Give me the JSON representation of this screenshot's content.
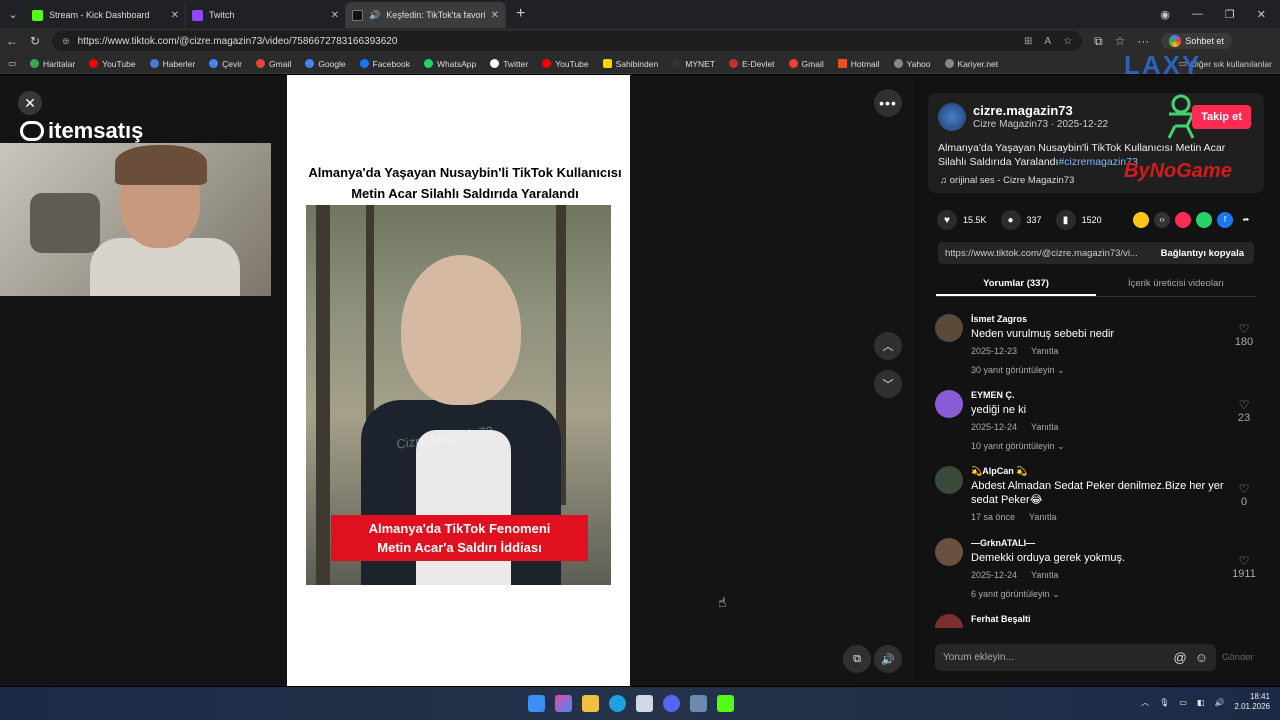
{
  "browser": {
    "tabs": [
      {
        "label": "Stream - Kick Dashboard",
        "color": "#53fc18"
      },
      {
        "label": "Twitch",
        "color": "#9146ff"
      },
      {
        "label": "Keşfedin: TikTok'ta favori vide",
        "color": "#111111"
      }
    ],
    "url": "https://www.tiktok.com/@cizre.magazin73/video/7586672783166393620",
    "sohbet_label": "Sohbet et",
    "bookmarks": [
      "Haritalar",
      "YouTube",
      "Haberler",
      "Çevir",
      "Gmail",
      "Google",
      "Facebook",
      "WhatsApp",
      "Twitter",
      "YouTube",
      "Sahibinden",
      "MYNET",
      "E-Devlet",
      "Gmail",
      "Hotmail",
      "Yahoo",
      "Kariyer.net"
    ],
    "bookmark_colors": [
      "#34a853",
      "#ff0000",
      "#4a7bd0",
      "#4285f4",
      "#ea4335",
      "#4285f4",
      "#1877f2",
      "#25d366",
      "#ffffff",
      "#ff0000",
      "#ffd400",
      "#333333",
      "#c4302b",
      "#ea4335",
      "#f25022",
      "#6001d2",
      "#888888"
    ],
    "other_bookmarks": "Diğer sık kullanılanlar"
  },
  "overlay": {
    "brand": "itemsatış",
    "watermark_logo": "LAXY",
    "sponsor": "ByNoGame"
  },
  "video": {
    "search_placeholder": "İlgili içeriği bulun",
    "headline": "Almanya'da Yaşayan Nusaybin'li TikTok Kullanıcısı Metin Acar Silahlı Saldırıda Yaralandı",
    "watermark": "Cizre Magazin73",
    "banner_line1": "Almanya'da TikTok Fenomeni",
    "banner_line2": "Metin Acar'a Saldırı İddiası"
  },
  "post": {
    "username": "cizre.magazin73",
    "display_name": "Cizre Magazin73",
    "date": "2025-12-22",
    "subline": "Cizre Magazin73 · 2025-12-22",
    "follow_label": "Takip et",
    "description": "Almanya'da Yaşayan Nusaybin'li TikTok Kullanıcısı Metin Acar Silahlı Saldırıda Yaralandı",
    "hashtag": "#cizremagazin73",
    "sound": "orijinal ses - Cizre Magazin73",
    "likes": "15.5K",
    "comments": "337",
    "saves": "1520",
    "share_link": "https://www.tiktok.com/@cizre.magazin73/vi...",
    "copy_label": "Bağlantıyı kopyala"
  },
  "tabs": {
    "comments_label": "Yorumlar (337)",
    "creator_label": "İçerik üreticisi videoları"
  },
  "comments": [
    {
      "user": "İsmet Zagros",
      "text": "Neden vurulmuş sebebi nedir",
      "date": "2025-12-23",
      "reply": "Yanıtla",
      "likes": "180",
      "replies": "30 yanıt görüntüleyin",
      "color": "#5a4a3a"
    },
    {
      "user": "EYMEN Ç.",
      "text": "yediği ne ki",
      "date": "2025-12-24",
      "reply": "Yanıtla",
      "likes": "23",
      "replies": "10 yanıt görüntüleyin",
      "color": "#8a5cd6"
    },
    {
      "user": "💫AlpCan 💫",
      "text": "Abdest Almadan Sedat Peker denilmez.Bize her yer sedat Peker😂",
      "date": "17 sa önce",
      "reply": "Yanıtla",
      "likes": "0",
      "replies": "",
      "color": "#3a4a3a"
    },
    {
      "user": "—GrknATALI—",
      "text": "Demekki orduya gerek yokmuş.",
      "date": "2025-12-24",
      "reply": "Yanıtla",
      "likes": "1911",
      "replies": "6 yanıt görüntüleyin",
      "color": "#6a5040"
    },
    {
      "user": "Ferhat Beşalti",
      "text": "",
      "date": "",
      "reply": "",
      "likes": "",
      "replies": "",
      "color": "#7a3030"
    }
  ],
  "input": {
    "placeholder": "Yorum ekleyin...",
    "send_label": "Gönder"
  },
  "taskbar": {
    "time": "18:41",
    "date": "2.01.2026"
  }
}
